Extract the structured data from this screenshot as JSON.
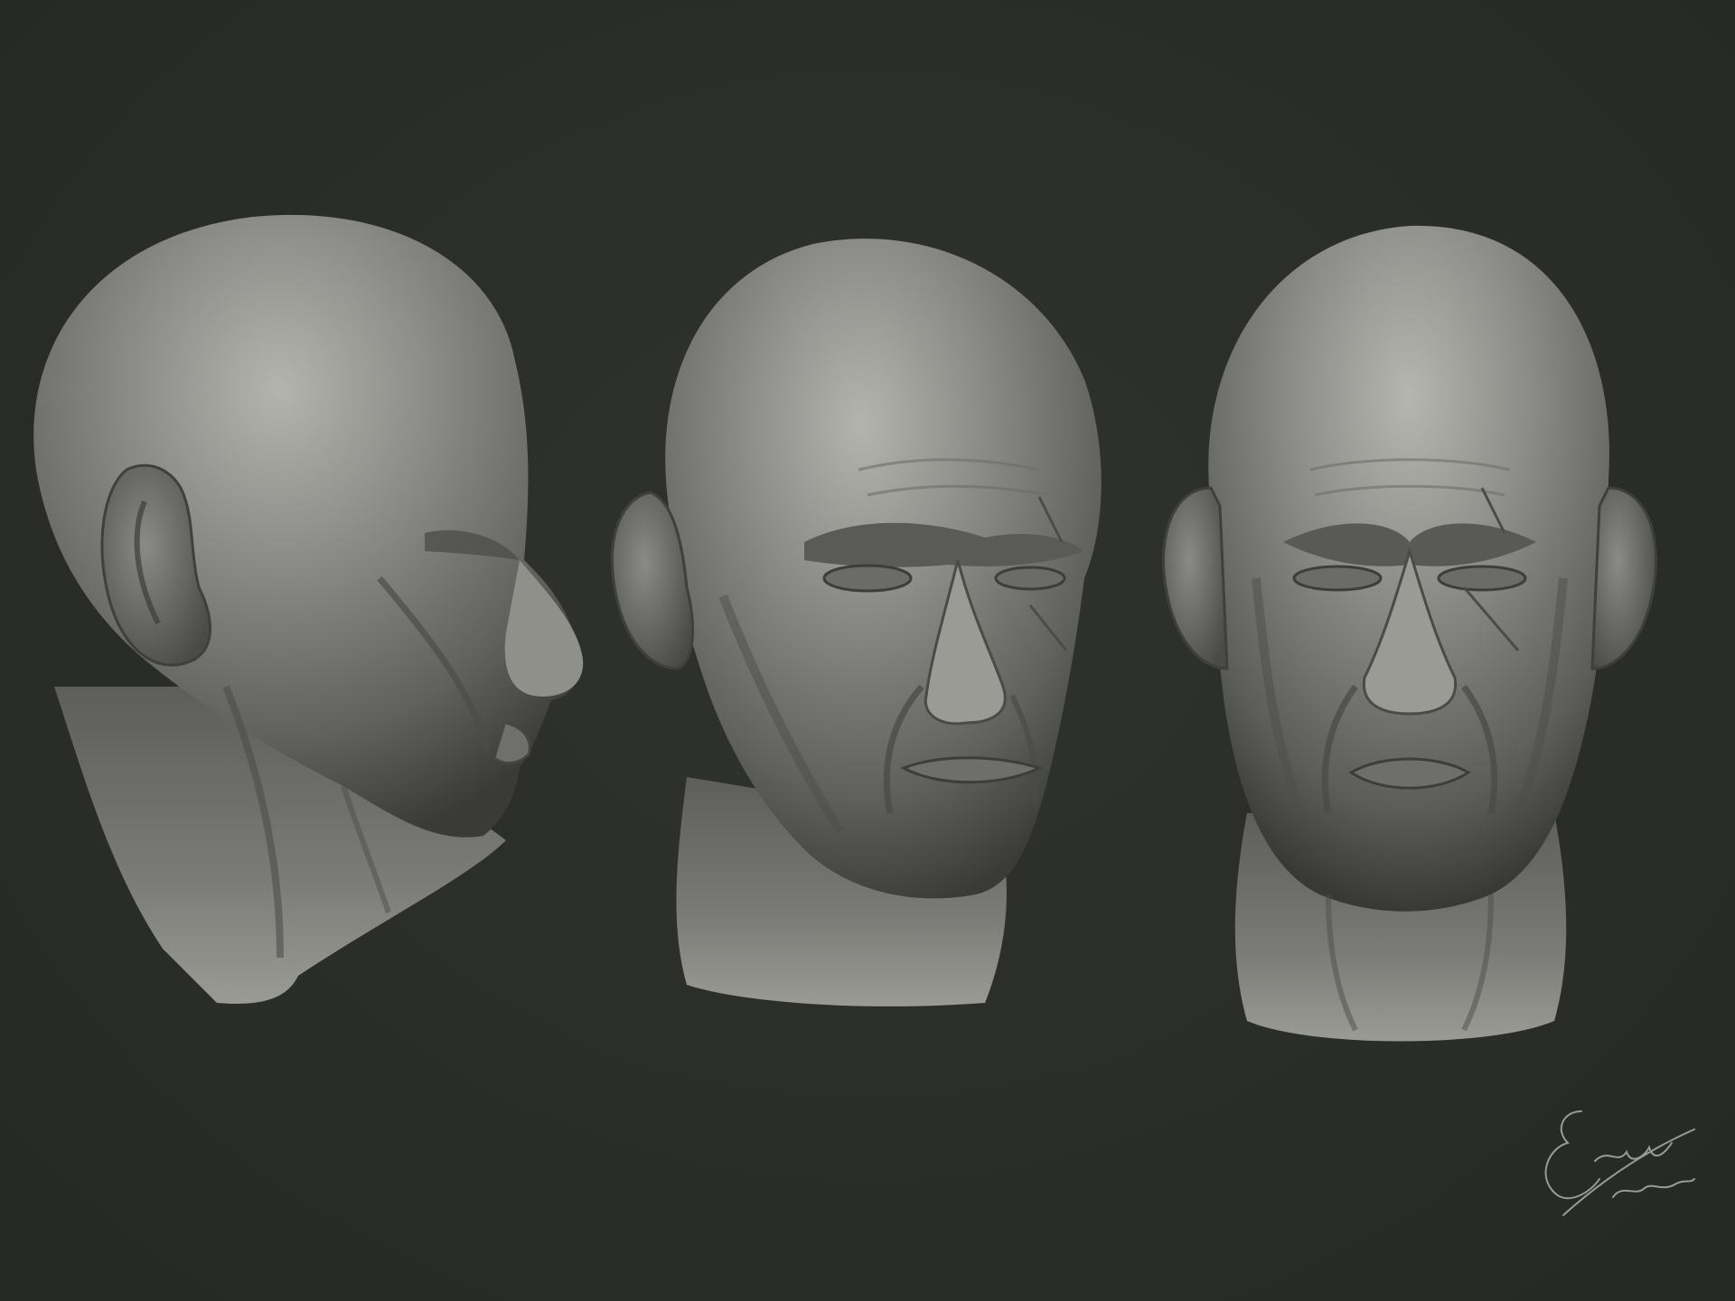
{
  "scene": {
    "background_color": "#2b2d29",
    "sculpt_color": "#7c7d78",
    "views": [
      {
        "name": "head-profile-view",
        "angle": "side"
      },
      {
        "name": "head-three-quarter-view",
        "angle": "three-quarter"
      },
      {
        "name": "head-front-view",
        "angle": "front"
      }
    ]
  },
  "signature": {
    "text": "Erlan Lidon",
    "color": "#9a9a96"
  }
}
